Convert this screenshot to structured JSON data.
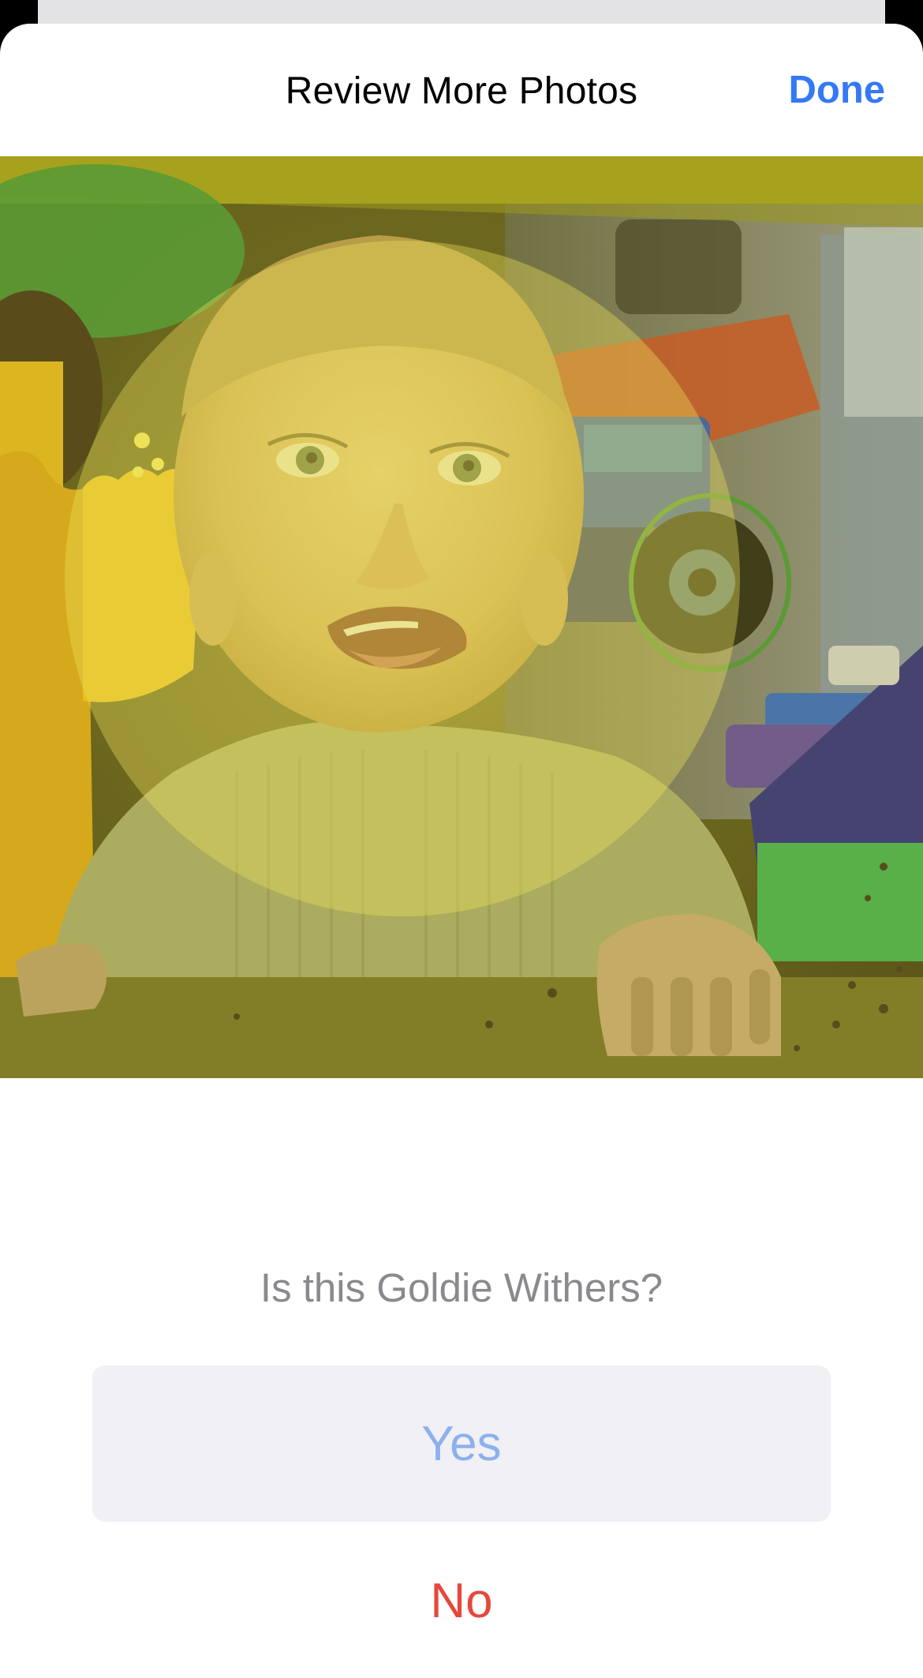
{
  "nav": {
    "title": "Review More Photos",
    "done_label": "Done"
  },
  "photo": {
    "subject": "face-highlight-photo"
  },
  "prompt": {
    "question": "Is this Goldie Withers?",
    "yes_label": "Yes",
    "no_label": "No"
  },
  "colors": {
    "accent_blue": "#3478f6",
    "destructive_red": "#e5483b",
    "yes_text": "#8db0ee",
    "yes_background": "#f0f0f5",
    "question_gray": "#8a8a8e"
  }
}
